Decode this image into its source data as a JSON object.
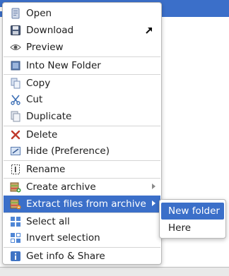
{
  "context_menu": {
    "items": [
      {
        "label": "Open",
        "icon": "open-folder-icon"
      },
      {
        "label": "Download",
        "icon": "save-disk-icon",
        "trailing_icon": "external-link-arrow-icon"
      },
      {
        "label": "Preview",
        "icon": "eye-icon"
      },
      {
        "label": "Into New Folder",
        "icon": "new-folder-icon"
      },
      {
        "label": "Copy",
        "icon": "copy-icon"
      },
      {
        "label": "Cut",
        "icon": "scissors-icon"
      },
      {
        "label": "Duplicate",
        "icon": "duplicate-icon"
      },
      {
        "label": "Delete",
        "icon": "delete-x-icon"
      },
      {
        "label": "Hide (Preference)",
        "icon": "hide-icon"
      },
      {
        "label": "Rename",
        "icon": "rename-icon"
      },
      {
        "label": "Create archive",
        "icon": "create-archive-icon",
        "has_submenu": true
      },
      {
        "label": "Extract files from archive",
        "icon": "extract-archive-icon",
        "has_submenu": true,
        "highlighted": true
      },
      {
        "label": "Select all",
        "icon": "select-all-icon"
      },
      {
        "label": "Invert selection",
        "icon": "invert-selection-icon"
      },
      {
        "label": "Get info & Share",
        "icon": "info-icon"
      }
    ]
  },
  "submenu": {
    "items": [
      {
        "label": "New folder",
        "highlighted": true
      },
      {
        "label": "Here"
      }
    ]
  },
  "colors": {
    "highlight": "#3b6fc9",
    "highlight_text": "#ffffff",
    "text": "#1c1c1c",
    "separator": "#d5d5d5"
  }
}
